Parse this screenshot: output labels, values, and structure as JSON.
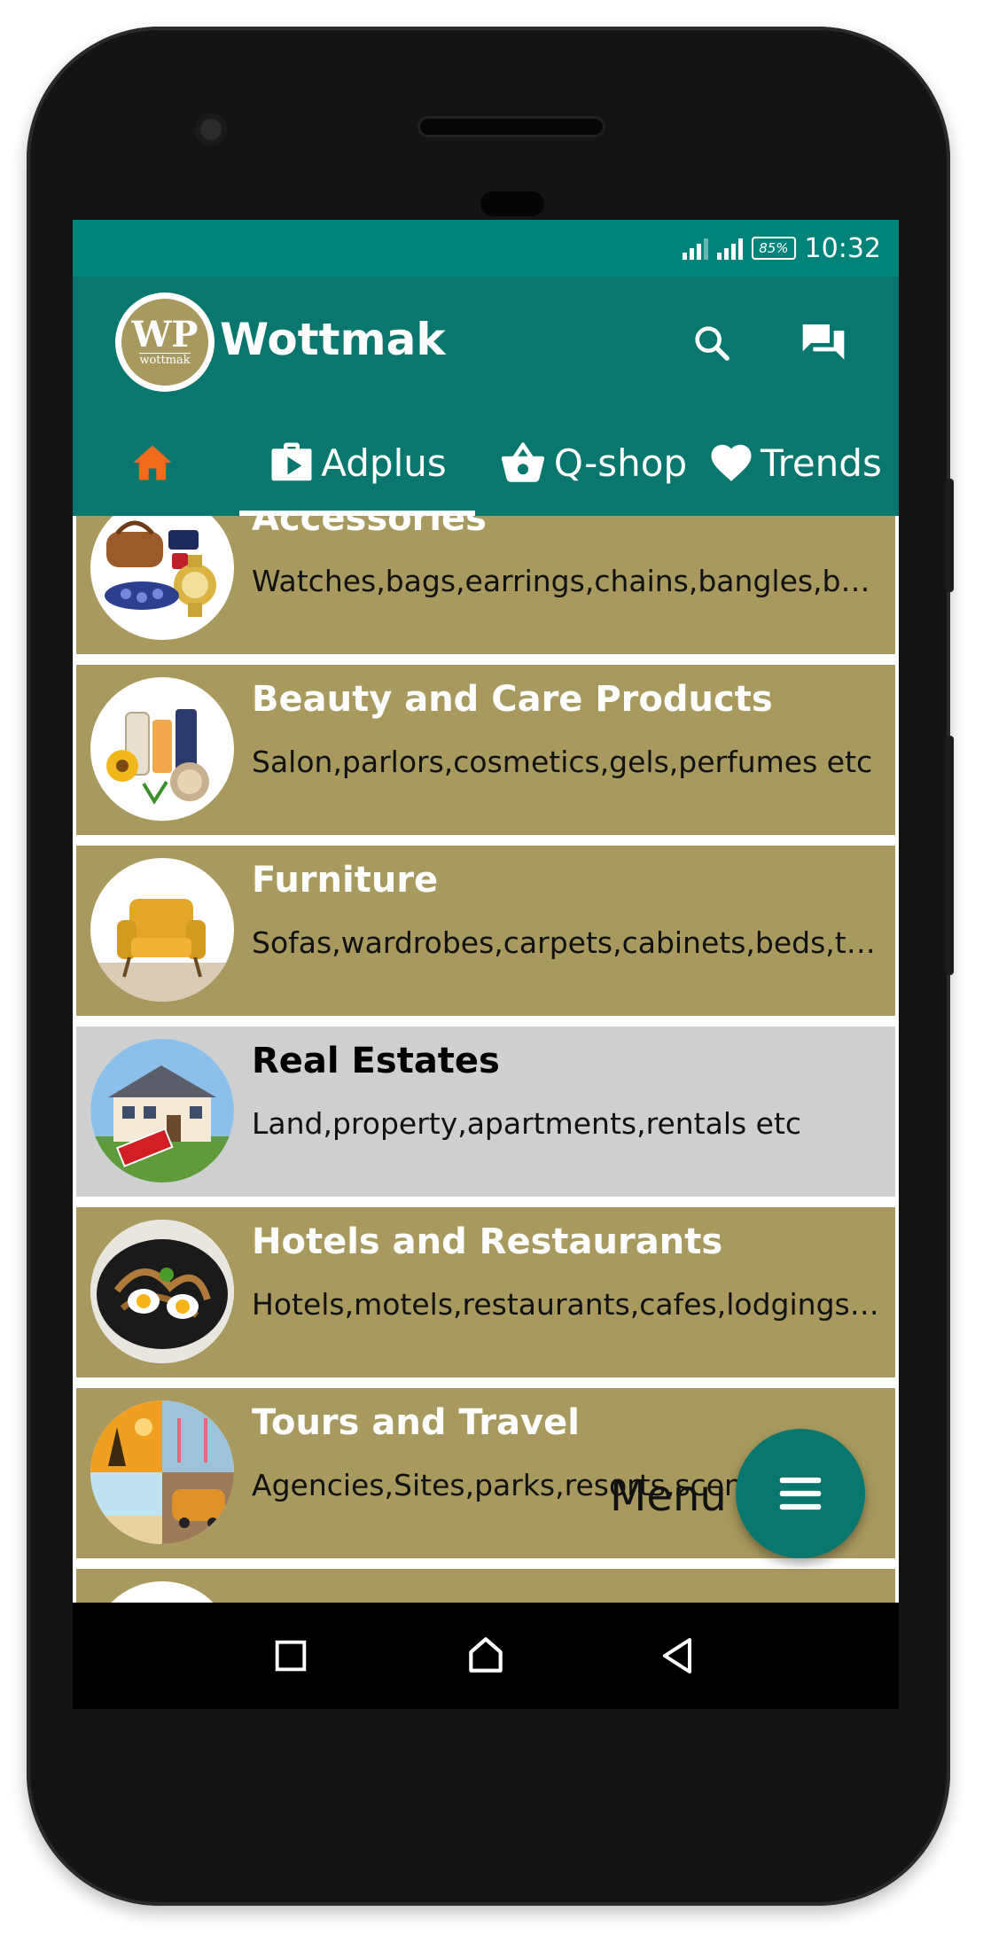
{
  "status_bar": {
    "battery": "85%",
    "time": "10:32"
  },
  "app_bar": {
    "logo_mark": "WP",
    "logo_word": "wottmak",
    "title": "Wottmak",
    "icons": [
      "search-icon",
      "forum-icon"
    ]
  },
  "tabs": [
    {
      "label": "",
      "icon": "home-icon",
      "selected": false
    },
    {
      "label": "Adplus",
      "icon": "play-bag-icon",
      "selected": true
    },
    {
      "label": "Q-shop",
      "icon": "basket-icon",
      "selected": false
    },
    {
      "label": "Trends",
      "icon": "heart-icon",
      "selected": false
    }
  ],
  "categories": [
    {
      "title": "Accessories",
      "subtitle": "Watches,bags,earrings,chains,bangles,belts etc"
    },
    {
      "title": "Beauty and Care Products",
      "subtitle": "Salon,parlors,cosmetics,gels,perfumes etc"
    },
    {
      "title": "Furniture",
      "subtitle": "Sofas,wardrobes,carpets,cabinets,beds,tables etc"
    },
    {
      "title": "Real Estates",
      "subtitle": "Land,property,apartments,rentals etc",
      "selected": true
    },
    {
      "title": "Hotels and Restaurants",
      "subtitle": "Hotels,motels,restaurants,cafes,lodgings etc"
    },
    {
      "title": "Tours and Travel",
      "subtitle": "Agencies,Sites,parks,resorts,scenery etc"
    }
  ],
  "fab": {
    "label": "Menu",
    "icon": "menu-icon"
  },
  "navigation_bar": {
    "icons": [
      "recents-icon",
      "home-icon",
      "back-icon"
    ]
  },
  "colors": {
    "primary": "#0a776e",
    "status_bar": "#00847a",
    "row_background": "#a8995e",
    "row_selected": "#cfcfcf",
    "home_tab_accent": "#f26b1d"
  }
}
